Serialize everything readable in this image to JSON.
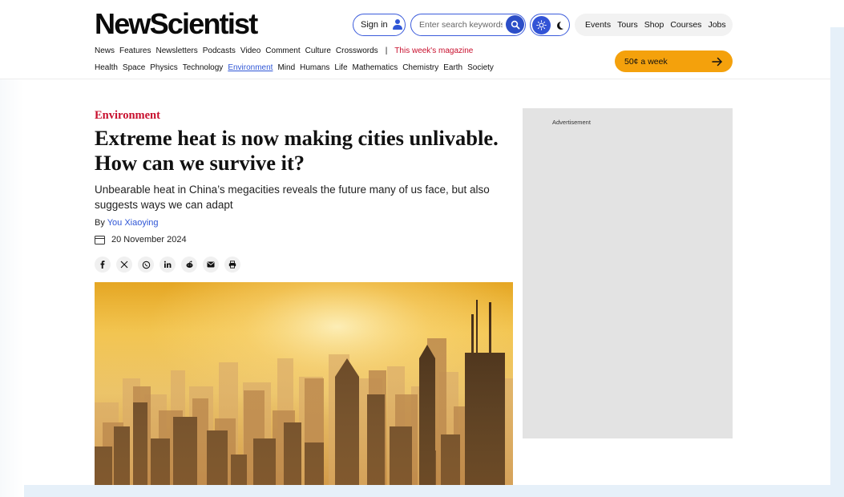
{
  "brand": {
    "logo": "NewScientist"
  },
  "header": {
    "signin_label": "Sign in",
    "search_placeholder": "Enter search keywords",
    "top_links": [
      "Events",
      "Tours",
      "Shop",
      "Courses",
      "Jobs"
    ],
    "subscribe_label": "50¢ a week"
  },
  "nav_primary": {
    "items": [
      "News",
      "Features",
      "Newsletters",
      "Podcasts",
      "Video",
      "Comment",
      "Culture",
      "Crosswords"
    ],
    "separator": "|",
    "magazine": "This week's magazine"
  },
  "nav_topics": {
    "items": [
      "Health",
      "Space",
      "Physics",
      "Technology",
      "Environment",
      "Mind",
      "Humans",
      "Life",
      "Mathematics",
      "Chemistry",
      "Earth",
      "Society"
    ],
    "active": "Environment"
  },
  "article": {
    "category": "Environment",
    "headline": "Extreme heat is now making cities unlivable. How can we survive it?",
    "standfirst": "Unbearable heat in China’s megacities reveals the future many of us face, but also suggests ways we can adapt",
    "by_prefix": "By",
    "author": "You Xiaoying",
    "date": "20 November 2024",
    "share_icons": [
      "facebook-icon",
      "x-icon",
      "whatsapp-icon",
      "linkedin-icon",
      "reddit-icon",
      "email-icon",
      "print-icon"
    ]
  },
  "ad": {
    "label": "Advertisement"
  },
  "colors": {
    "brand_red": "#c8102e",
    "link_blue": "#2f56d6",
    "subscribe_orange": "#f4a10c"
  }
}
